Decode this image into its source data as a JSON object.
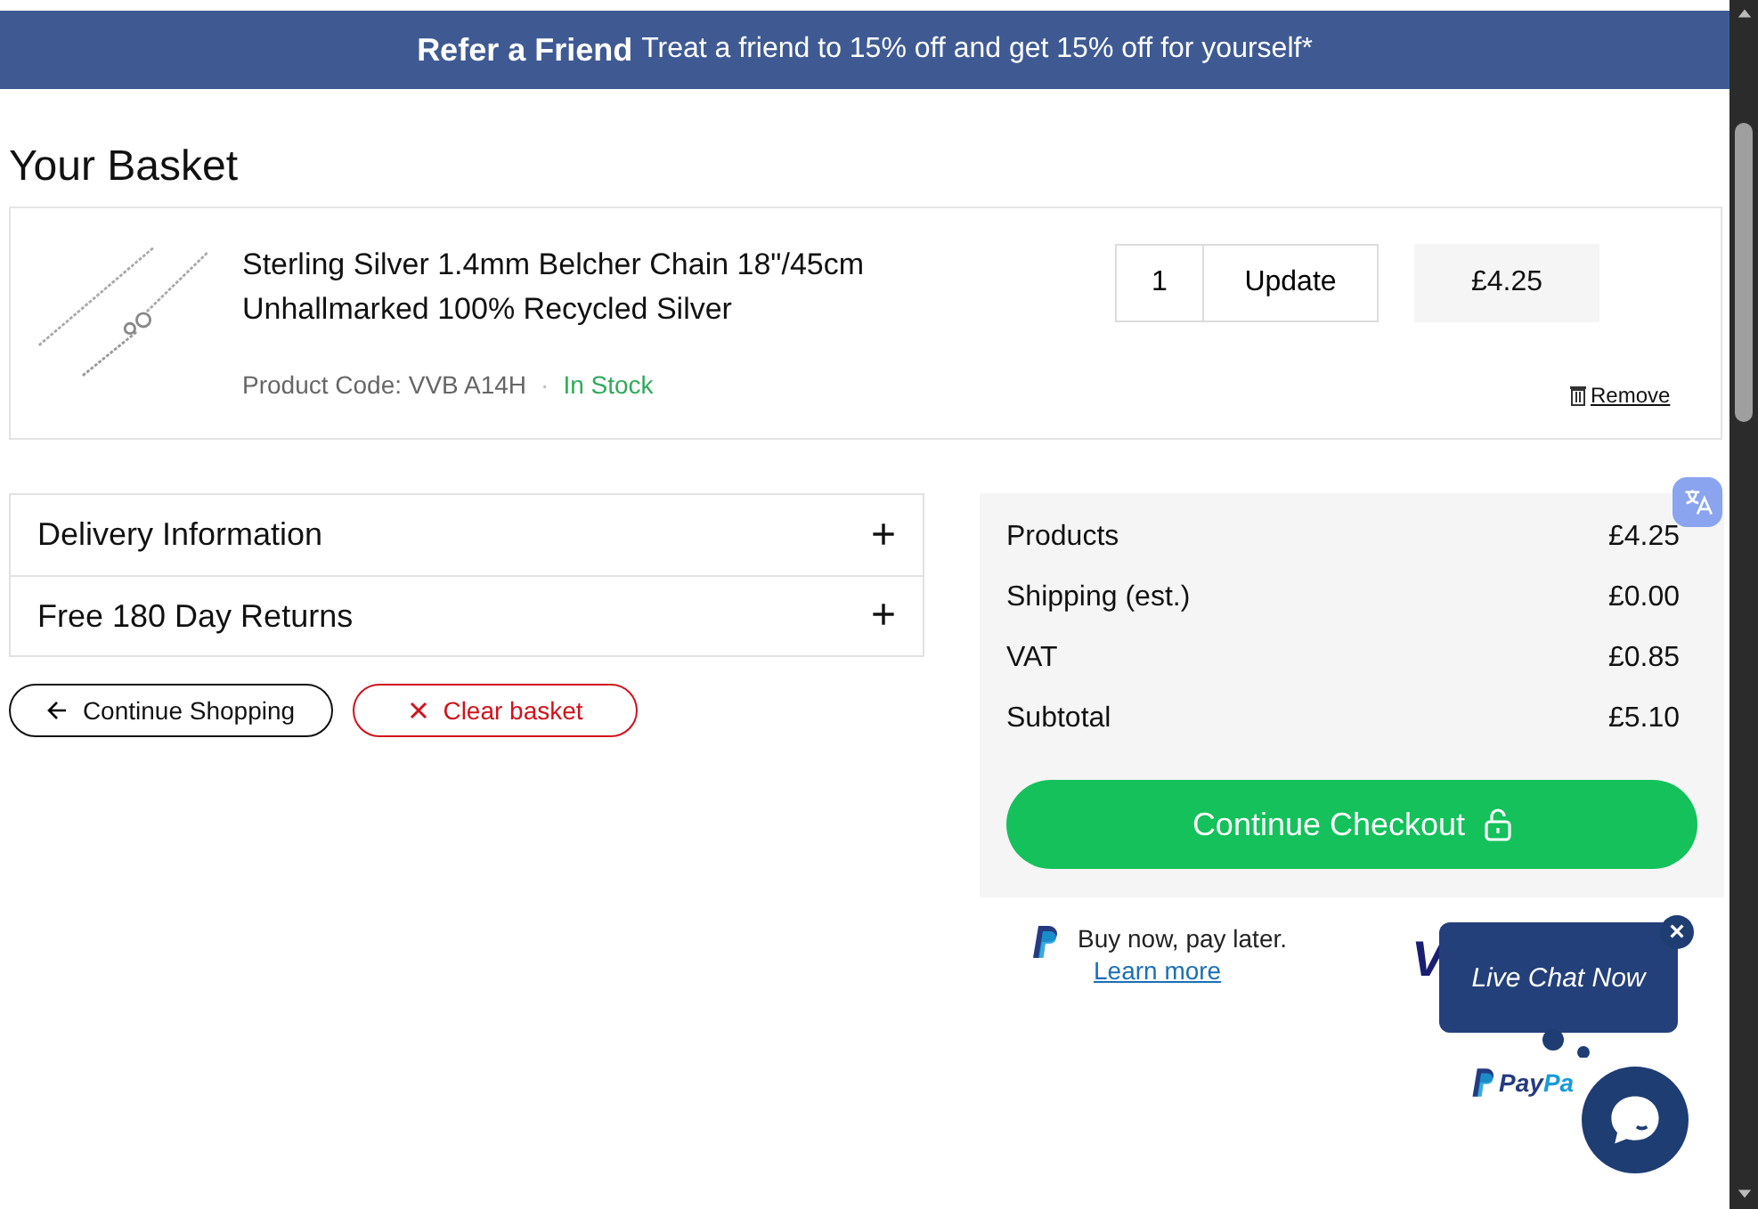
{
  "banner": {
    "title": "Refer a Friend",
    "text": "Treat a friend to 15% off and get 15% off for yourself*"
  },
  "page_title": "Your Basket",
  "basket_item": {
    "name_lines": [
      "Sterling Silver 1.4mm Belcher Chain 18\"/45cm",
      "Unhallmarked 100% Recycled Silver"
    ],
    "product_code": "Product Code: VVB A14H",
    "separator": "·",
    "stock": "In Stock",
    "quantity": "1",
    "update_button": "Update",
    "price": "£4.25",
    "remove_link": "Remove"
  },
  "accordions": [
    {
      "label": "Delivery Information",
      "expanded": false,
      "toggle": "+"
    },
    {
      "label": "Free 180 Day Returns",
      "expanded": false,
      "toggle": "+"
    }
  ],
  "buttons": [
    {
      "kind": "back",
      "label": "Continue Shopping"
    },
    {
      "kind": "clear",
      "label": "Clear basket"
    }
  ],
  "summary": {
    "rows": [
      {
        "label": "Products",
        "value": "£4.25"
      },
      {
        "label": "Shipping (est.)",
        "value": "£0.00"
      },
      {
        "label": "VAT",
        "value": "£0.85"
      },
      {
        "label": "Subtotal",
        "value": "£5.10"
      }
    ],
    "checkout_button": "Continue Checkout"
  },
  "paylater": {
    "text": "Buy now, pay later.",
    "link": "Learn more"
  },
  "payment_logos": {
    "visa": "V",
    "paypal": "PayPa"
  },
  "live_chat": {
    "label": "Live Chat Now",
    "close": "×"
  }
}
